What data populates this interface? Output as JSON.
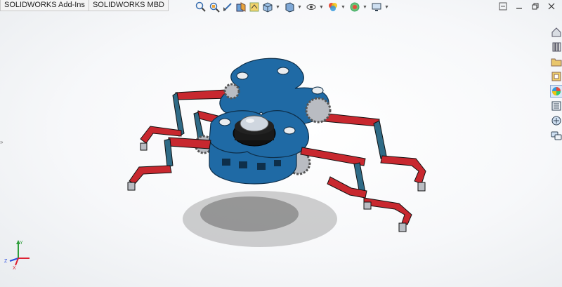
{
  "tabs": [
    {
      "label": "SOLIDWORKS Add-Ins"
    },
    {
      "label": "SOLIDWORKS MBD"
    }
  ],
  "hud_toolbar": {
    "items": [
      "zoom-to-fit-icon",
      "zoom-to-area-icon",
      "previous-view-icon",
      "section-view-icon",
      "dynamic-annotation-icon",
      "view-orientation-icon",
      "display-style-icon",
      "hide-show-items-icon",
      "edit-appearance-icon",
      "apply-scene-icon",
      "view-settings-icon"
    ]
  },
  "window_controls": [
    "help-icon",
    "minimize-icon",
    "restore-icon",
    "close-icon"
  ],
  "task_pane": [
    "solidworks-resources-icon",
    "design-library-icon",
    "file-explorer-icon",
    "view-palette-icon",
    "appearances-icon",
    "custom-properties-icon",
    "solidworks-forum-icon",
    "community-icon"
  ],
  "triad": {
    "axes": [
      "Y",
      "X",
      "Z"
    ]
  },
  "colors": {
    "body_blue": "#1f6aa5",
    "leg_red": "#c8282f",
    "gear_gray": "#b9bcc2",
    "link_teal": "#2f6b86"
  }
}
